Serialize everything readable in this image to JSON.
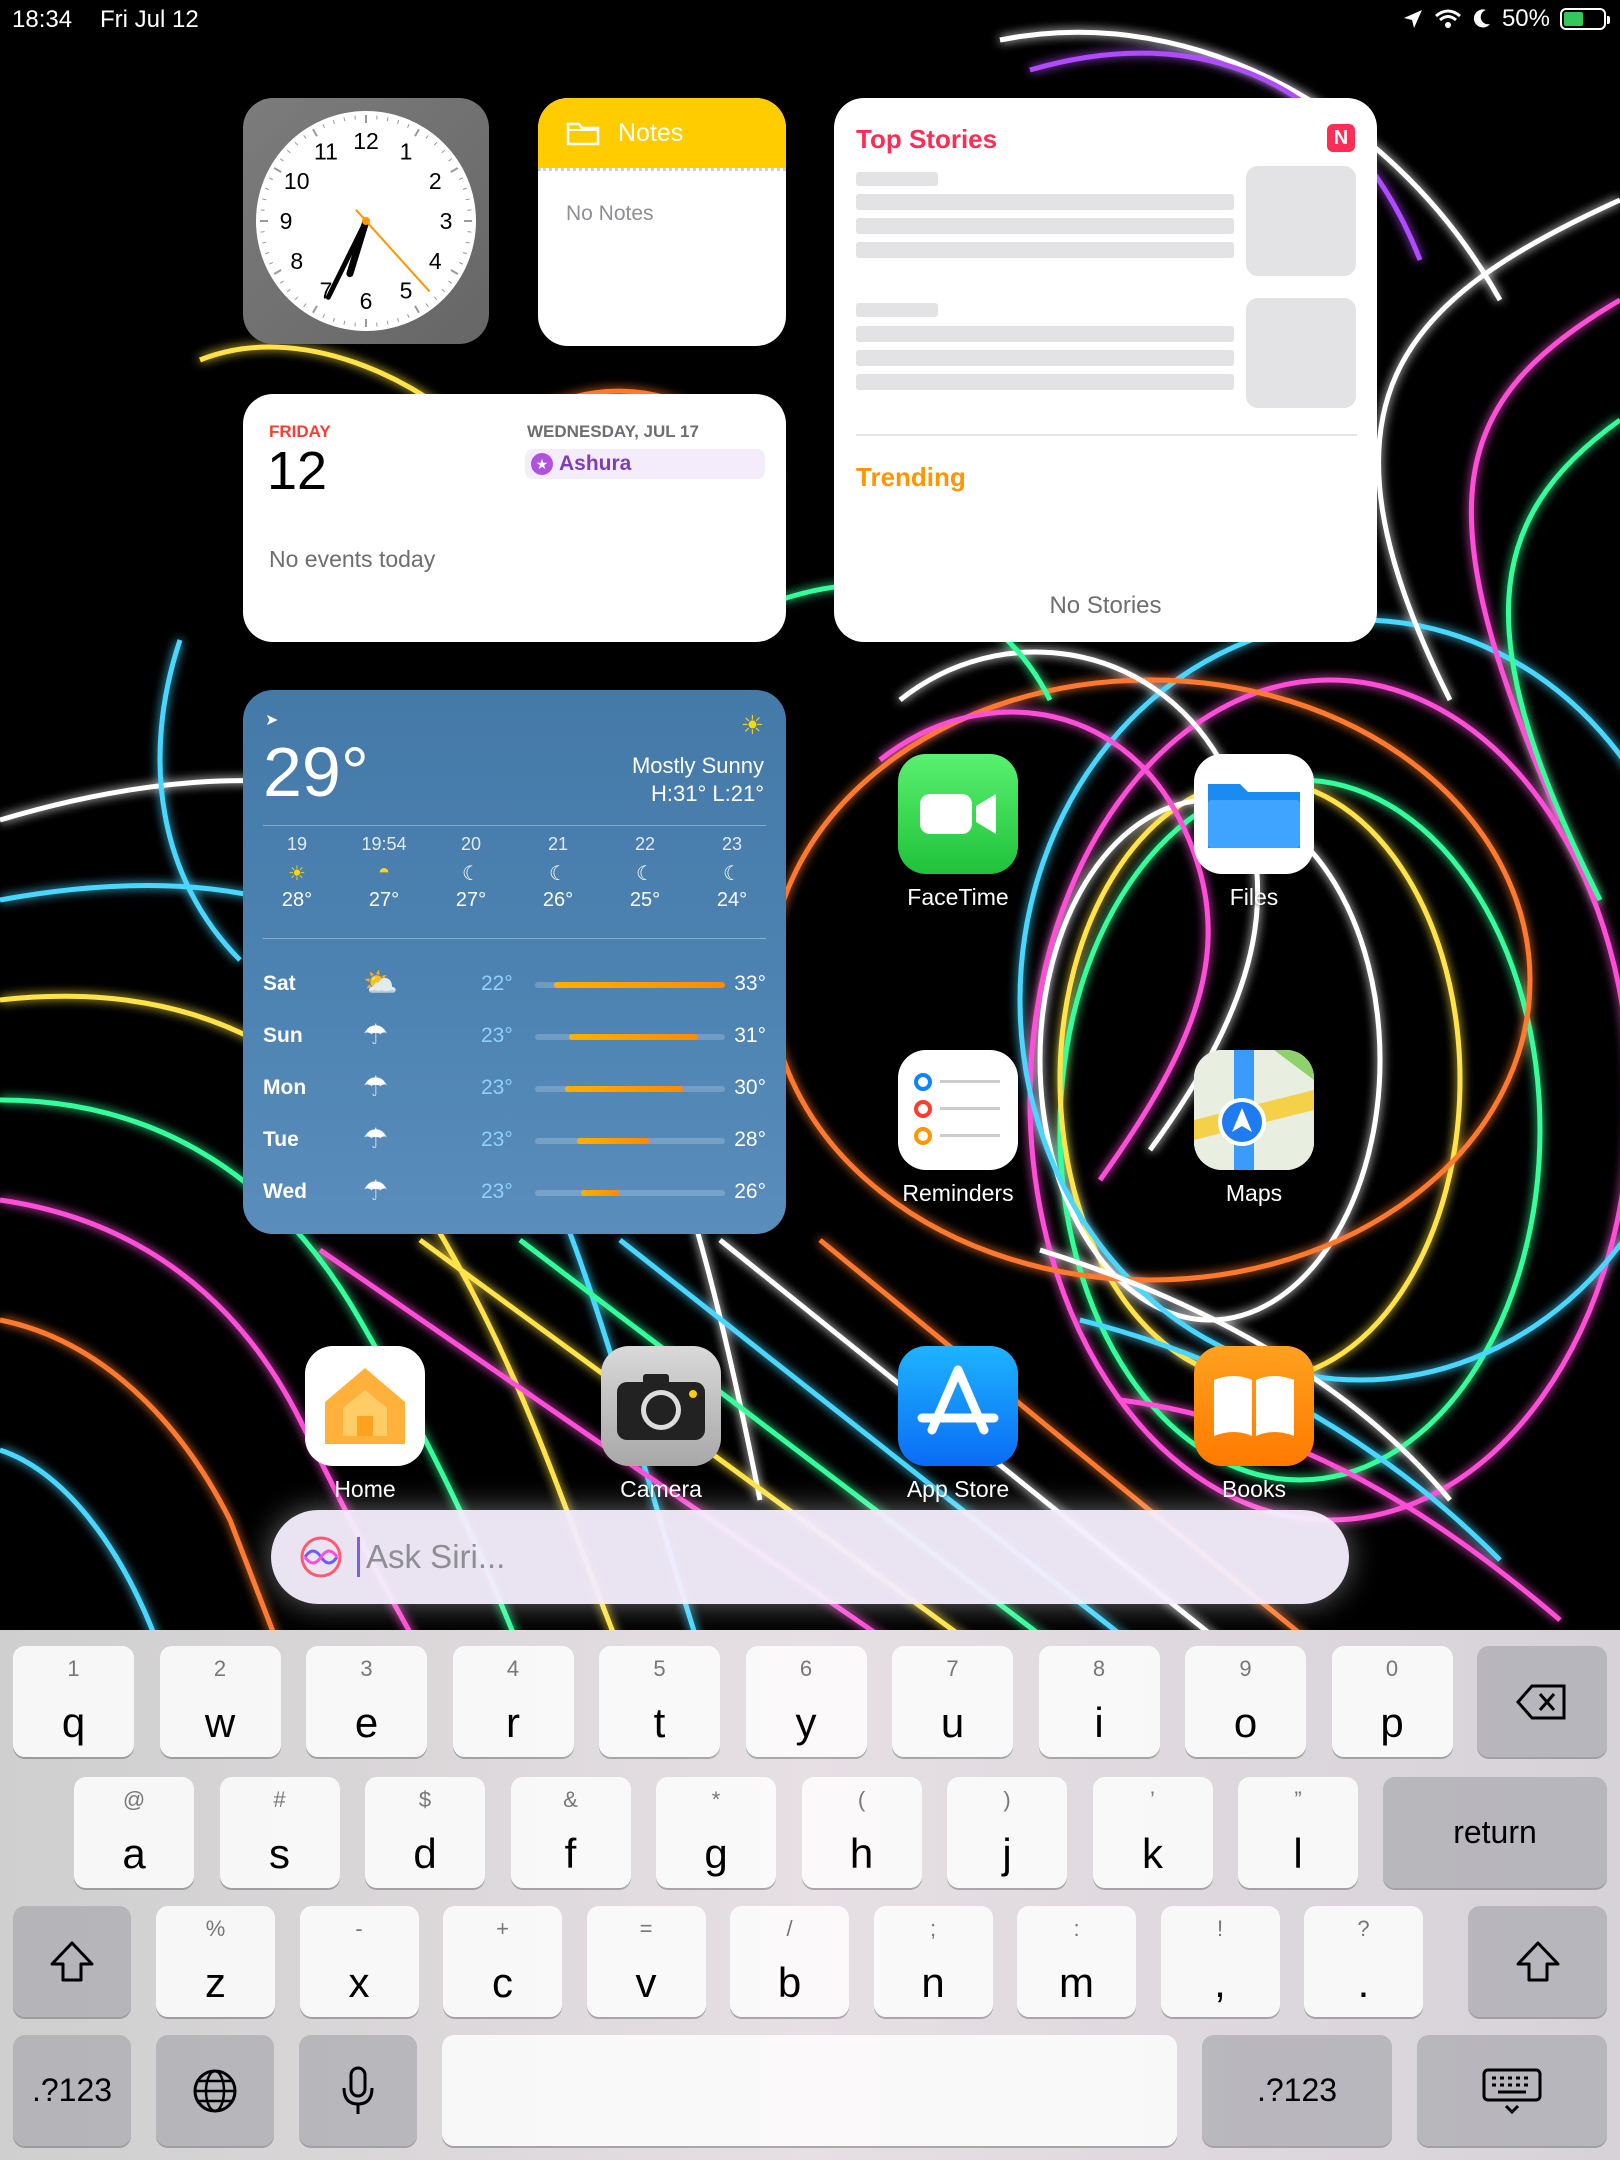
{
  "status_bar": {
    "time": "18:34",
    "date": "Fri Jul 12",
    "battery": "50%",
    "battery_level": 0.5
  },
  "clock_widget": {
    "hour": 18,
    "minute": 34,
    "second": 23,
    "numbers": [
      "12",
      "1",
      "2",
      "3",
      "4",
      "5",
      "6",
      "7",
      "8",
      "9",
      "10",
      "11"
    ]
  },
  "notes_widget": {
    "title": "Notes",
    "empty_text": "No Notes"
  },
  "calendar_widget": {
    "weekday": "FRIDAY",
    "day": "12",
    "next_date": "WEDNESDAY, JUL 17",
    "event": "Ashura",
    "empty_text": "No events today"
  },
  "news_widget": {
    "title": "Top Stories",
    "trending": "Trending",
    "empty_text": "No Stories"
  },
  "weather_widget": {
    "temp": "29°",
    "condition": "Mostly Sunny",
    "high_low": "H:31° L:21°",
    "hourly": [
      {
        "label": "19",
        "icon": "sun",
        "temp": "28°"
      },
      {
        "label": "19:54",
        "icon": "sunset",
        "temp": "27°"
      },
      {
        "label": "20",
        "icon": "moon",
        "temp": "27°"
      },
      {
        "label": "21",
        "icon": "moon",
        "temp": "26°"
      },
      {
        "label": "22",
        "icon": "moon",
        "temp": "25°"
      },
      {
        "label": "23",
        "icon": "moon",
        "temp": "24°"
      }
    ],
    "daily": [
      {
        "day": "Sat",
        "icon": "partly-sunny",
        "low": "22°",
        "high": "33°",
        "range": [
          0.1,
          1.0
        ]
      },
      {
        "day": "Sun",
        "icon": "rain",
        "low": "23°",
        "high": "31°",
        "range": [
          0.18,
          0.86
        ]
      },
      {
        "day": "Mon",
        "icon": "rain",
        "low": "23°",
        "high": "30°",
        "range": [
          0.16,
          0.78
        ]
      },
      {
        "day": "Tue",
        "icon": "rain",
        "low": "23°",
        "high": "28°",
        "range": [
          0.22,
          0.6
        ]
      },
      {
        "day": "Wed",
        "icon": "rain",
        "low": "23°",
        "high": "26°",
        "range": [
          0.24,
          0.44
        ]
      }
    ]
  },
  "apps": {
    "facetime": "FaceTime",
    "files": "Files",
    "reminders": "Reminders",
    "maps": "Maps",
    "home": "Home",
    "camera": "Camera",
    "appstore": "App Store",
    "books": "Books"
  },
  "siri": {
    "placeholder": "Ask Siri..."
  },
  "keyboard": {
    "row1": [
      [
        "1",
        "q"
      ],
      [
        "2",
        "w"
      ],
      [
        "3",
        "e"
      ],
      [
        "4",
        "r"
      ],
      [
        "5",
        "t"
      ],
      [
        "6",
        "y"
      ],
      [
        "7",
        "u"
      ],
      [
        "8",
        "i"
      ],
      [
        "9",
        "o"
      ],
      [
        "0",
        "p"
      ]
    ],
    "row2": [
      [
        "@",
        "a"
      ],
      [
        "#",
        "s"
      ],
      [
        "$",
        "d"
      ],
      [
        "&",
        "f"
      ],
      [
        "*",
        "g"
      ],
      [
        "(",
        "h"
      ],
      [
        ")",
        "j"
      ],
      [
        "’",
        "k"
      ],
      [
        "”",
        "l"
      ]
    ],
    "row3": [
      [
        "%",
        "z"
      ],
      [
        "-",
        "x"
      ],
      [
        "+",
        "c"
      ],
      [
        "=",
        "v"
      ],
      [
        "/",
        "b"
      ],
      [
        ";",
        "n"
      ],
      [
        ":",
        "m"
      ],
      [
        "!",
        ","
      ],
      [
        "?",
        "."
      ]
    ],
    "return_label": "return",
    "numbers_label": ".?123"
  }
}
